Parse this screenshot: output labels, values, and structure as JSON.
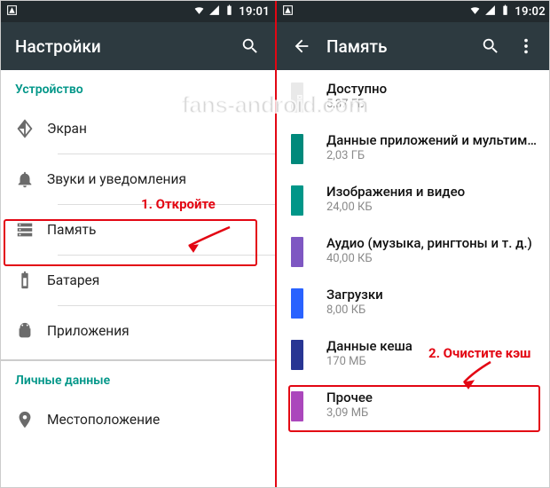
{
  "watermark": "fans-android.com",
  "left": {
    "status": {
      "time": "19:01"
    },
    "appbar": {
      "title": "Настройки"
    },
    "section1": "Устройство",
    "items": [
      {
        "id": "display",
        "label": "Экран",
        "icon": "display-icon"
      },
      {
        "id": "sound",
        "label": "Звуки и уведомления",
        "icon": "bell-icon"
      },
      {
        "id": "storage",
        "label": "Память",
        "icon": "storage-icon"
      },
      {
        "id": "battery",
        "label": "Батарея",
        "icon": "battery-icon"
      },
      {
        "id": "apps",
        "label": "Приложения",
        "icon": "apps-icon"
      }
    ],
    "section2": "Личные данные",
    "items2": [
      {
        "id": "location",
        "label": "Местоположение",
        "icon": "location-icon"
      }
    ]
  },
  "right": {
    "status": {
      "time": "19:02"
    },
    "appbar": {
      "title": "Память"
    },
    "rows": [
      {
        "title": "Доступно",
        "sub": "5,37 ГБ",
        "color": "#e9e9e9"
      },
      {
        "title": "Данные приложений и мультимедиа",
        "sub": "2,03 ГБ",
        "color": "#00897b"
      },
      {
        "title": "Изображения и видео",
        "sub": "24,00 КБ",
        "color": "#009688"
      },
      {
        "title": "Аудио (музыка, рингтоны и т. д.)",
        "sub": "40,00 КБ",
        "color": "#7e57c2"
      },
      {
        "title": "Загрузки",
        "sub": "8,00 КБ",
        "color": "#2962ff"
      },
      {
        "title": "Данные кеша",
        "sub": "170 МБ",
        "color": "#283593"
      },
      {
        "title": "Прочее",
        "sub": "3,09 МБ",
        "color": "#ab47bc"
      }
    ]
  },
  "annotations": {
    "step1_text": "1. Откройте",
    "step2_text": "2. Очистите кэш"
  }
}
